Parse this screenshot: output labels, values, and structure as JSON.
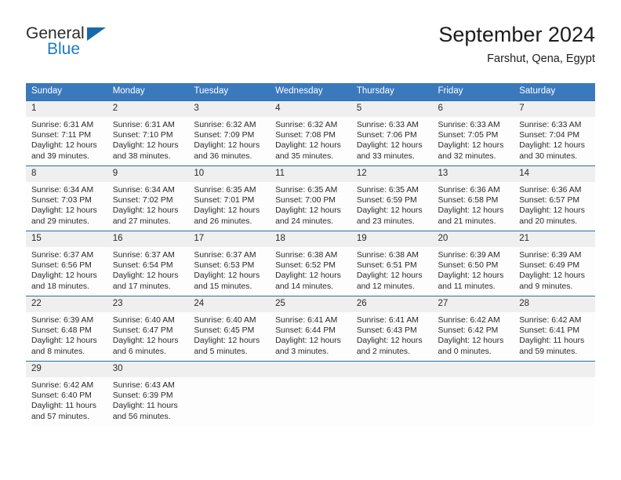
{
  "brand": {
    "line1": "General",
    "line2": "Blue",
    "accent_color": "#1a7dc4",
    "triangle_color": "#1769ab"
  },
  "header": {
    "month_title": "September 2024",
    "location": "Farshut, Qena, Egypt"
  },
  "theme": {
    "header_row_bg": "#3b79bd",
    "daynum_bg": "#efefef",
    "row_border": "#2f6ca8",
    "text": "#2a2a2a"
  },
  "weekday_headers": [
    "Sunday",
    "Monday",
    "Tuesday",
    "Wednesday",
    "Thursday",
    "Friday",
    "Saturday"
  ],
  "weeks": [
    [
      {
        "day": "1",
        "sunrise": "Sunrise: 6:31 AM",
        "sunset": "Sunset: 7:11 PM",
        "daylight1": "Daylight: 12 hours",
        "daylight2": "and 39 minutes."
      },
      {
        "day": "2",
        "sunrise": "Sunrise: 6:31 AM",
        "sunset": "Sunset: 7:10 PM",
        "daylight1": "Daylight: 12 hours",
        "daylight2": "and 38 minutes."
      },
      {
        "day": "3",
        "sunrise": "Sunrise: 6:32 AM",
        "sunset": "Sunset: 7:09 PM",
        "daylight1": "Daylight: 12 hours",
        "daylight2": "and 36 minutes."
      },
      {
        "day": "4",
        "sunrise": "Sunrise: 6:32 AM",
        "sunset": "Sunset: 7:08 PM",
        "daylight1": "Daylight: 12 hours",
        "daylight2": "and 35 minutes."
      },
      {
        "day": "5",
        "sunrise": "Sunrise: 6:33 AM",
        "sunset": "Sunset: 7:06 PM",
        "daylight1": "Daylight: 12 hours",
        "daylight2": "and 33 minutes."
      },
      {
        "day": "6",
        "sunrise": "Sunrise: 6:33 AM",
        "sunset": "Sunset: 7:05 PM",
        "daylight1": "Daylight: 12 hours",
        "daylight2": "and 32 minutes."
      },
      {
        "day": "7",
        "sunrise": "Sunrise: 6:33 AM",
        "sunset": "Sunset: 7:04 PM",
        "daylight1": "Daylight: 12 hours",
        "daylight2": "and 30 minutes."
      }
    ],
    [
      {
        "day": "8",
        "sunrise": "Sunrise: 6:34 AM",
        "sunset": "Sunset: 7:03 PM",
        "daylight1": "Daylight: 12 hours",
        "daylight2": "and 29 minutes."
      },
      {
        "day": "9",
        "sunrise": "Sunrise: 6:34 AM",
        "sunset": "Sunset: 7:02 PM",
        "daylight1": "Daylight: 12 hours",
        "daylight2": "and 27 minutes."
      },
      {
        "day": "10",
        "sunrise": "Sunrise: 6:35 AM",
        "sunset": "Sunset: 7:01 PM",
        "daylight1": "Daylight: 12 hours",
        "daylight2": "and 26 minutes."
      },
      {
        "day": "11",
        "sunrise": "Sunrise: 6:35 AM",
        "sunset": "Sunset: 7:00 PM",
        "daylight1": "Daylight: 12 hours",
        "daylight2": "and 24 minutes."
      },
      {
        "day": "12",
        "sunrise": "Sunrise: 6:35 AM",
        "sunset": "Sunset: 6:59 PM",
        "daylight1": "Daylight: 12 hours",
        "daylight2": "and 23 minutes."
      },
      {
        "day": "13",
        "sunrise": "Sunrise: 6:36 AM",
        "sunset": "Sunset: 6:58 PM",
        "daylight1": "Daylight: 12 hours",
        "daylight2": "and 21 minutes."
      },
      {
        "day": "14",
        "sunrise": "Sunrise: 6:36 AM",
        "sunset": "Sunset: 6:57 PM",
        "daylight1": "Daylight: 12 hours",
        "daylight2": "and 20 minutes."
      }
    ],
    [
      {
        "day": "15",
        "sunrise": "Sunrise: 6:37 AM",
        "sunset": "Sunset: 6:56 PM",
        "daylight1": "Daylight: 12 hours",
        "daylight2": "and 18 minutes."
      },
      {
        "day": "16",
        "sunrise": "Sunrise: 6:37 AM",
        "sunset": "Sunset: 6:54 PM",
        "daylight1": "Daylight: 12 hours",
        "daylight2": "and 17 minutes."
      },
      {
        "day": "17",
        "sunrise": "Sunrise: 6:37 AM",
        "sunset": "Sunset: 6:53 PM",
        "daylight1": "Daylight: 12 hours",
        "daylight2": "and 15 minutes."
      },
      {
        "day": "18",
        "sunrise": "Sunrise: 6:38 AM",
        "sunset": "Sunset: 6:52 PM",
        "daylight1": "Daylight: 12 hours",
        "daylight2": "and 14 minutes."
      },
      {
        "day": "19",
        "sunrise": "Sunrise: 6:38 AM",
        "sunset": "Sunset: 6:51 PM",
        "daylight1": "Daylight: 12 hours",
        "daylight2": "and 12 minutes."
      },
      {
        "day": "20",
        "sunrise": "Sunrise: 6:39 AM",
        "sunset": "Sunset: 6:50 PM",
        "daylight1": "Daylight: 12 hours",
        "daylight2": "and 11 minutes."
      },
      {
        "day": "21",
        "sunrise": "Sunrise: 6:39 AM",
        "sunset": "Sunset: 6:49 PM",
        "daylight1": "Daylight: 12 hours",
        "daylight2": "and 9 minutes."
      }
    ],
    [
      {
        "day": "22",
        "sunrise": "Sunrise: 6:39 AM",
        "sunset": "Sunset: 6:48 PM",
        "daylight1": "Daylight: 12 hours",
        "daylight2": "and 8 minutes."
      },
      {
        "day": "23",
        "sunrise": "Sunrise: 6:40 AM",
        "sunset": "Sunset: 6:47 PM",
        "daylight1": "Daylight: 12 hours",
        "daylight2": "and 6 minutes."
      },
      {
        "day": "24",
        "sunrise": "Sunrise: 6:40 AM",
        "sunset": "Sunset: 6:45 PM",
        "daylight1": "Daylight: 12 hours",
        "daylight2": "and 5 minutes."
      },
      {
        "day": "25",
        "sunrise": "Sunrise: 6:41 AM",
        "sunset": "Sunset: 6:44 PM",
        "daylight1": "Daylight: 12 hours",
        "daylight2": "and 3 minutes."
      },
      {
        "day": "26",
        "sunrise": "Sunrise: 6:41 AM",
        "sunset": "Sunset: 6:43 PM",
        "daylight1": "Daylight: 12 hours",
        "daylight2": "and 2 minutes."
      },
      {
        "day": "27",
        "sunrise": "Sunrise: 6:42 AM",
        "sunset": "Sunset: 6:42 PM",
        "daylight1": "Daylight: 12 hours",
        "daylight2": "and 0 minutes."
      },
      {
        "day": "28",
        "sunrise": "Sunrise: 6:42 AM",
        "sunset": "Sunset: 6:41 PM",
        "daylight1": "Daylight: 11 hours",
        "daylight2": "and 59 minutes."
      }
    ],
    [
      {
        "day": "29",
        "sunrise": "Sunrise: 6:42 AM",
        "sunset": "Sunset: 6:40 PM",
        "daylight1": "Daylight: 11 hours",
        "daylight2": "and 57 minutes."
      },
      {
        "day": "30",
        "sunrise": "Sunrise: 6:43 AM",
        "sunset": "Sunset: 6:39 PM",
        "daylight1": "Daylight: 11 hours",
        "daylight2": "and 56 minutes."
      },
      {
        "day": "",
        "sunrise": "",
        "sunset": "",
        "daylight1": "",
        "daylight2": ""
      },
      {
        "day": "",
        "sunrise": "",
        "sunset": "",
        "daylight1": "",
        "daylight2": ""
      },
      {
        "day": "",
        "sunrise": "",
        "sunset": "",
        "daylight1": "",
        "daylight2": ""
      },
      {
        "day": "",
        "sunrise": "",
        "sunset": "",
        "daylight1": "",
        "daylight2": ""
      },
      {
        "day": "",
        "sunrise": "",
        "sunset": "",
        "daylight1": "",
        "daylight2": ""
      }
    ]
  ]
}
